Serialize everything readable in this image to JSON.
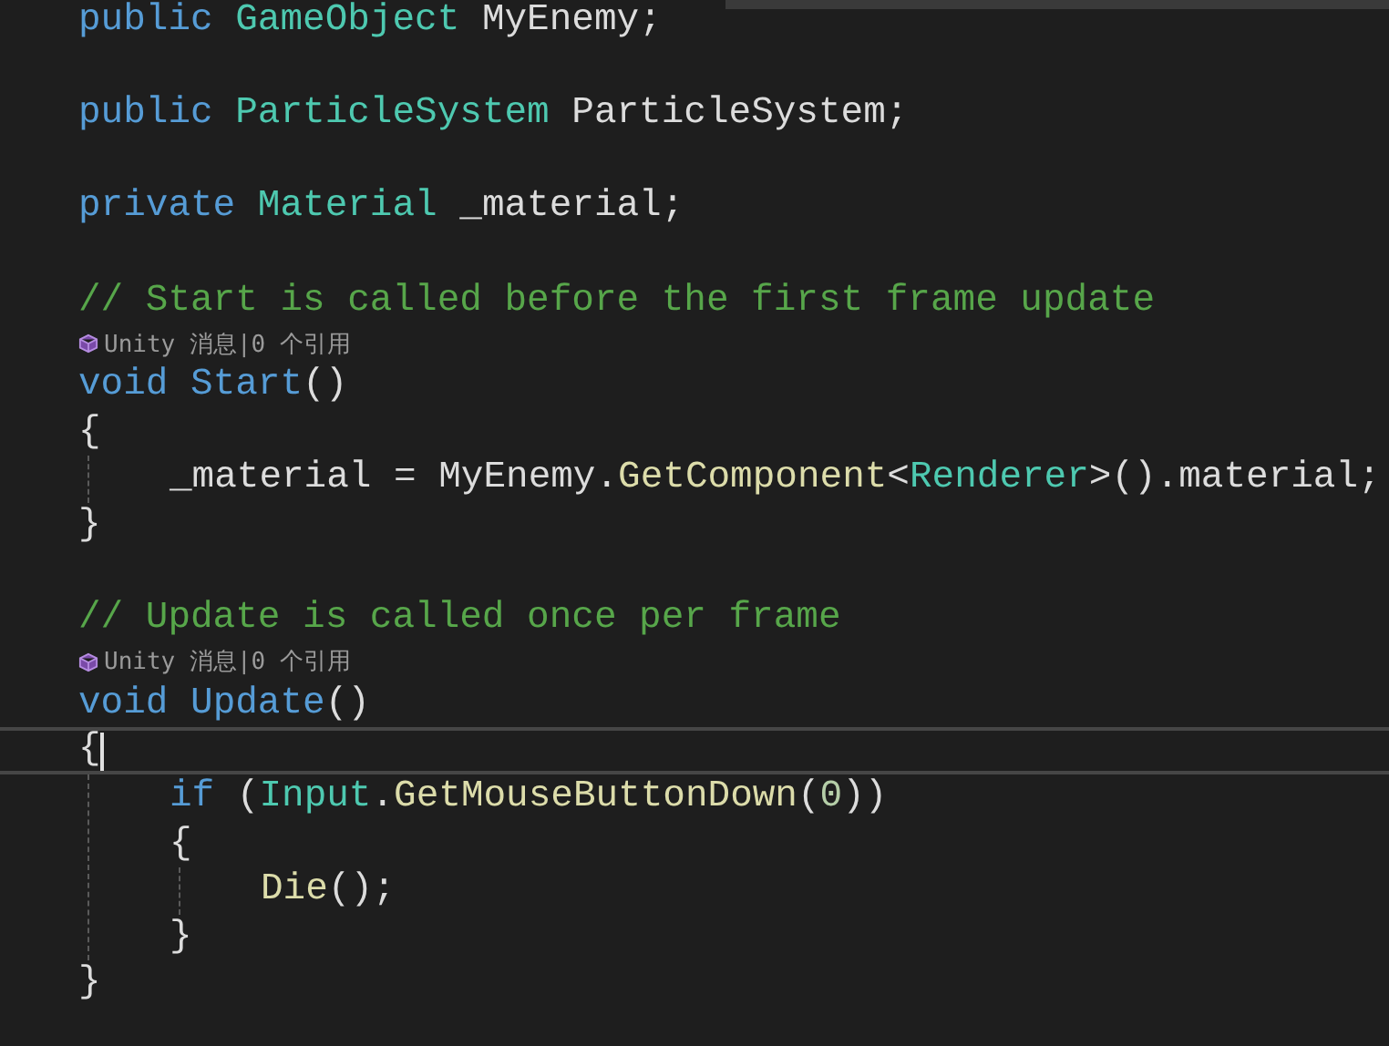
{
  "editor": {
    "lines": [
      {
        "kind": "code",
        "current": false,
        "tokens": [
          {
            "kind": "keyword",
            "text": "public "
          },
          {
            "kind": "type",
            "text": "GameObject "
          },
          {
            "kind": "plain",
            "text": "MyEnemy;"
          }
        ]
      },
      {
        "kind": "blank"
      },
      {
        "kind": "code",
        "current": false,
        "tokens": [
          {
            "kind": "keyword",
            "text": "public "
          },
          {
            "kind": "type",
            "text": "ParticleSystem "
          },
          {
            "kind": "plain",
            "text": "ParticleSystem;"
          }
        ]
      },
      {
        "kind": "blank"
      },
      {
        "kind": "code",
        "current": false,
        "tokens": [
          {
            "kind": "keyword",
            "text": "private "
          },
          {
            "kind": "type",
            "text": "Material "
          },
          {
            "kind": "plain",
            "text": "_material;"
          }
        ]
      },
      {
        "kind": "blank"
      },
      {
        "kind": "code",
        "current": false,
        "tokens": [
          {
            "kind": "comment",
            "text": "// Start is called before the first frame update"
          }
        ]
      },
      {
        "kind": "codelens",
        "text": "Unity 消息|0 个引用"
      },
      {
        "kind": "code",
        "current": false,
        "tokens": [
          {
            "kind": "keyword",
            "text": "void "
          },
          {
            "kind": "method",
            "text": "Start"
          },
          {
            "kind": "plain",
            "text": "()"
          }
        ]
      },
      {
        "kind": "code",
        "current": false,
        "tokens": [
          {
            "kind": "plain",
            "text": "{"
          }
        ],
        "children": [
          {
            "kind": "code",
            "current": false,
            "tokens": [
              {
                "kind": "plain",
                "text": "_material = MyEnemy."
              },
              {
                "kind": "call",
                "text": "GetComponent"
              },
              {
                "kind": "plain",
                "text": "<"
              },
              {
                "kind": "type",
                "text": "Renderer"
              },
              {
                "kind": "plain",
                "text": ">().material;"
              }
            ]
          }
        ]
      },
      {
        "kind": "code",
        "current": false,
        "tokens": [
          {
            "kind": "plain",
            "text": "}"
          }
        ]
      },
      {
        "kind": "blank"
      },
      {
        "kind": "code",
        "current": false,
        "tokens": [
          {
            "kind": "comment",
            "text": "// Update is called once per frame"
          }
        ]
      },
      {
        "kind": "codelens",
        "text": "Unity 消息|0 个引用"
      },
      {
        "kind": "code",
        "current": false,
        "tokens": [
          {
            "kind": "keyword",
            "text": "void "
          },
          {
            "kind": "method",
            "text": "Update"
          },
          {
            "kind": "plain",
            "text": "()"
          }
        ]
      },
      {
        "kind": "code",
        "current": true,
        "tokens": [
          {
            "kind": "plain",
            "text": "{"
          }
        ],
        "children": [
          {
            "kind": "code",
            "current": false,
            "tokens": [
              {
                "kind": "keyword",
                "text": "if "
              },
              {
                "kind": "plain",
                "text": "("
              },
              {
                "kind": "type",
                "text": "Input"
              },
              {
                "kind": "plain",
                "text": "."
              },
              {
                "kind": "call",
                "text": "GetMouseButtonDown"
              },
              {
                "kind": "plain",
                "text": "("
              },
              {
                "kind": "number",
                "text": "0"
              },
              {
                "kind": "plain",
                "text": "))"
              }
            ]
          },
          {
            "kind": "code",
            "current": false,
            "tokens": [
              {
                "kind": "plain",
                "text": "{"
              }
            ],
            "children": [
              {
                "kind": "code",
                "current": false,
                "tokens": [
                  {
                    "kind": "call",
                    "text": "Die"
                  },
                  {
                    "kind": "plain",
                    "text": "();"
                  }
                ]
              }
            ]
          },
          {
            "kind": "code",
            "current": false,
            "tokens": [
              {
                "kind": "plain",
                "text": "}"
              }
            ]
          }
        ]
      },
      {
        "kind": "code",
        "current": false,
        "tokens": [
          {
            "kind": "plain",
            "text": "}"
          }
        ]
      }
    ]
  }
}
